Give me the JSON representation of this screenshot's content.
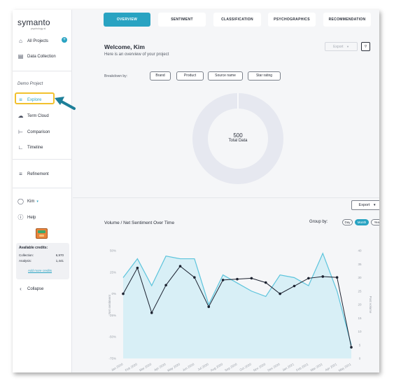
{
  "app": {
    "logo": "symanto",
    "logo_sub": "psychology ai"
  },
  "sidebar": {
    "all_projects": "All Projects",
    "data_collection": "Data Collection",
    "section": "Demo Project",
    "explore": "Explore",
    "term_cloud": "Term Cloud",
    "comparison": "Comparison",
    "timeline": "Timeline",
    "refinement": "Refinement",
    "user": "Kim",
    "help": "Help",
    "credits": {
      "title": "Available credits:",
      "collection_label": "Collection:",
      "collection_value": "6,970",
      "analysis_label": "Analysis:",
      "analysis_value": "1,441",
      "add_link": "Add more credits"
    },
    "collapse": "Collapse"
  },
  "tabs": [
    {
      "label": "OVERVIEW",
      "active": true
    },
    {
      "label": "SENTIMENT",
      "active": false
    },
    {
      "label": "CLASSIFICATION",
      "active": false
    },
    {
      "label": "PSYCHOGRAPHICS",
      "active": false
    },
    {
      "label": "RECOMMENDATION",
      "active": false
    }
  ],
  "header": {
    "welcome": "Welcome, Kim",
    "subtitle": "Here is an overview of your project",
    "export_label": "Export",
    "breakdown_label": "Breakdown by:",
    "breakdown_options": [
      "Brand",
      "Product",
      "Source name",
      "Star rating"
    ]
  },
  "donut": {
    "value": "500",
    "label": "Total Data"
  },
  "timeline": {
    "export_label": "Export",
    "title": "Volume / Net Sentiment Over Time",
    "group_by_label": "Group by:",
    "group_by_options": [
      {
        "label": "Day",
        "active": false
      },
      {
        "label": "Month",
        "active": true
      },
      {
        "label": "Year",
        "active": false
      }
    ]
  },
  "colors": {
    "accent": "#29a3c2",
    "volume_line": "#5cc4dc",
    "volume_fill": "#d8eff6",
    "sentiment_line": "#1c2230",
    "donut": "#e6e8f0"
  },
  "chart_data": {
    "type": "line",
    "x": [
      "Jan 2020",
      "Feb 2020",
      "Mar 2020",
      "Apr 2020",
      "May 2020",
      "Jun 2020",
      "Jul 2020",
      "Aug 2020",
      "Sep 2020",
      "Oct 2020",
      "Nov 2020",
      "Dec 2020",
      "Jan 2021",
      "Feb 2021",
      "Mar 2021",
      "Apr 2021",
      "May 2021"
    ],
    "series": [
      {
        "name": "Post volume",
        "axis": "right",
        "values": [
          30,
          37,
          27,
          38,
          37,
          37,
          20,
          31,
          28,
          25,
          23,
          31,
          30,
          27,
          39,
          25,
          5
        ]
      },
      {
        "name": "Net sentiment",
        "axis": "left",
        "values": [
          0,
          30,
          -22,
          10,
          32,
          19,
          -15,
          16,
          17,
          18,
          13,
          0,
          9,
          18,
          20,
          19,
          -62
        ]
      }
    ],
    "y_left": {
      "label": "Net sentiment",
      "min": -75,
      "max": 50,
      "ticks": [
        "50%",
        "25%",
        "0%",
        "-25%",
        "-50%",
        "-75%"
      ]
    },
    "y_right": {
      "label": "Post volume",
      "min": 0,
      "max": 40,
      "ticks": [
        "40",
        "35",
        "30",
        "25",
        "20",
        "15",
        "10",
        "5",
        "0"
      ]
    },
    "legend": [
      "Post volume",
      "Net sentiment"
    ],
    "legend_position": "bottom",
    "grid": false
  }
}
